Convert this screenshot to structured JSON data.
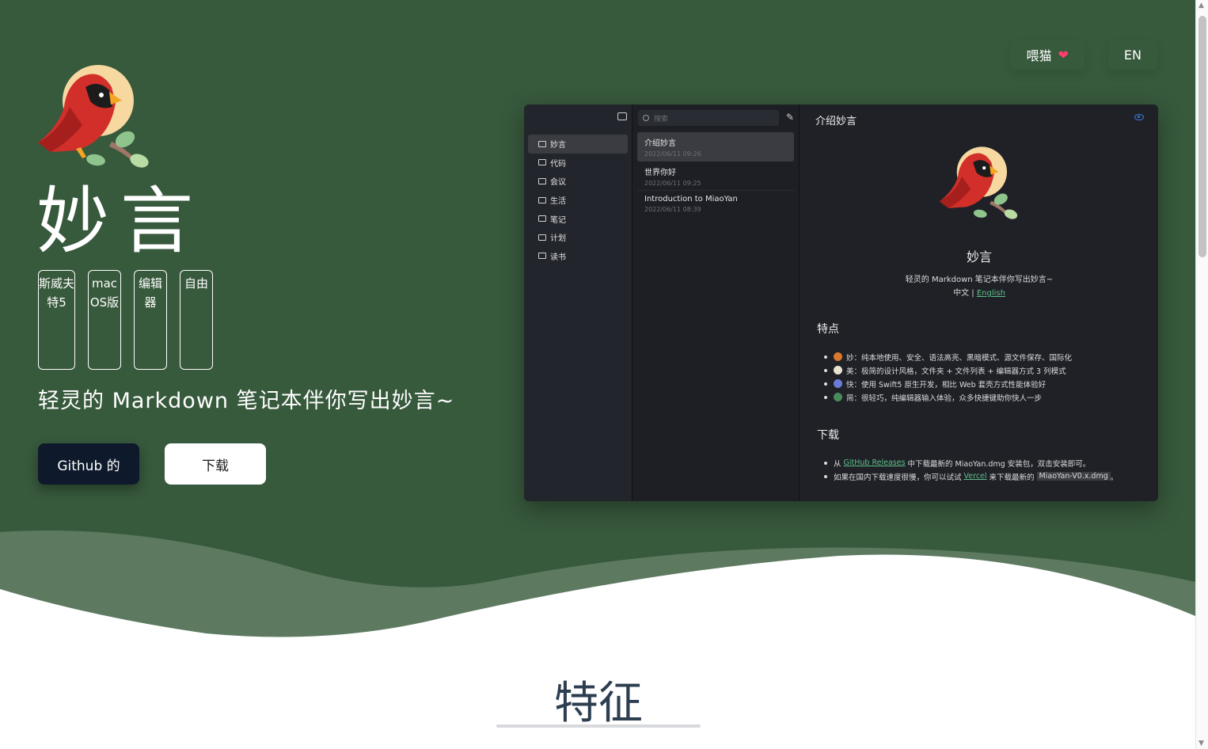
{
  "nav": {
    "feed_label": "喂猫",
    "feed_icon": "heart-icon",
    "lang_label": "EN"
  },
  "hero": {
    "title": "妙言",
    "tags": [
      "斯威夫特5",
      "macOS版",
      "编辑器",
      "自由"
    ],
    "subtitle": "轻灵的 Markdown 笔记本伴你写出妙言~",
    "github_button": "Github 的",
    "download_button": "下载"
  },
  "app": {
    "search_placeholder": "搜索",
    "folders": [
      "妙言",
      "代码",
      "会议",
      "生活",
      "笔记",
      "计划",
      "读书"
    ],
    "notes": [
      {
        "title": "介绍妙言",
        "date": "2022/06/11 09:26"
      },
      {
        "title": "世界你好",
        "date": "2022/06/11 09:25"
      },
      {
        "title": "Introduction to MiaoYan",
        "date": "2022/06/11 08:39"
      }
    ],
    "editor": {
      "doc_title": "介绍妙言",
      "name": "妙言",
      "slogan": "轻灵的 Markdown 笔记本伴你写出妙言~",
      "lang_prefix": "中文 | ",
      "lang_link": "English",
      "features_heading": "特点",
      "features": [
        {
          "icon_color": "#d9772b",
          "text": "妙：纯本地使用、安全、语法高亮、黑暗模式、源文件保存、国际化"
        },
        {
          "icon_color": "#e8e2d0",
          "text": "美：极简的设计风格，文件夹 + 文件列表 + 编辑器方式 3 列模式"
        },
        {
          "icon_color": "#6a7bd8",
          "text": "快：使用 Swift5 原生开发，相比 Web 套壳方式性能体验好"
        },
        {
          "icon_color": "#4a8b5a",
          "text": "简：很轻巧，纯编辑器输入体验，众多快捷键助你快人一步"
        }
      ],
      "download_heading": "下载",
      "download_items": [
        {
          "prefix": "从",
          "link": "GitHub Releases",
          "suffix": "中下载最新的 MiaoYan.dmg 安装包，双击安装即可。"
        },
        {
          "prefix": "如果在国内下载速度很慢，你可以试试",
          "link": "Vercel",
          "suffix": "来下载最新的",
          "code": "MiaoYan-V0.x.dmg",
          "end": "。"
        }
      ]
    }
  },
  "section": {
    "features_title": "特征"
  },
  "colors": {
    "hero_bg": "#37593c",
    "accent_link": "#5fbf8a",
    "github_btn": "#0e1a2b"
  }
}
